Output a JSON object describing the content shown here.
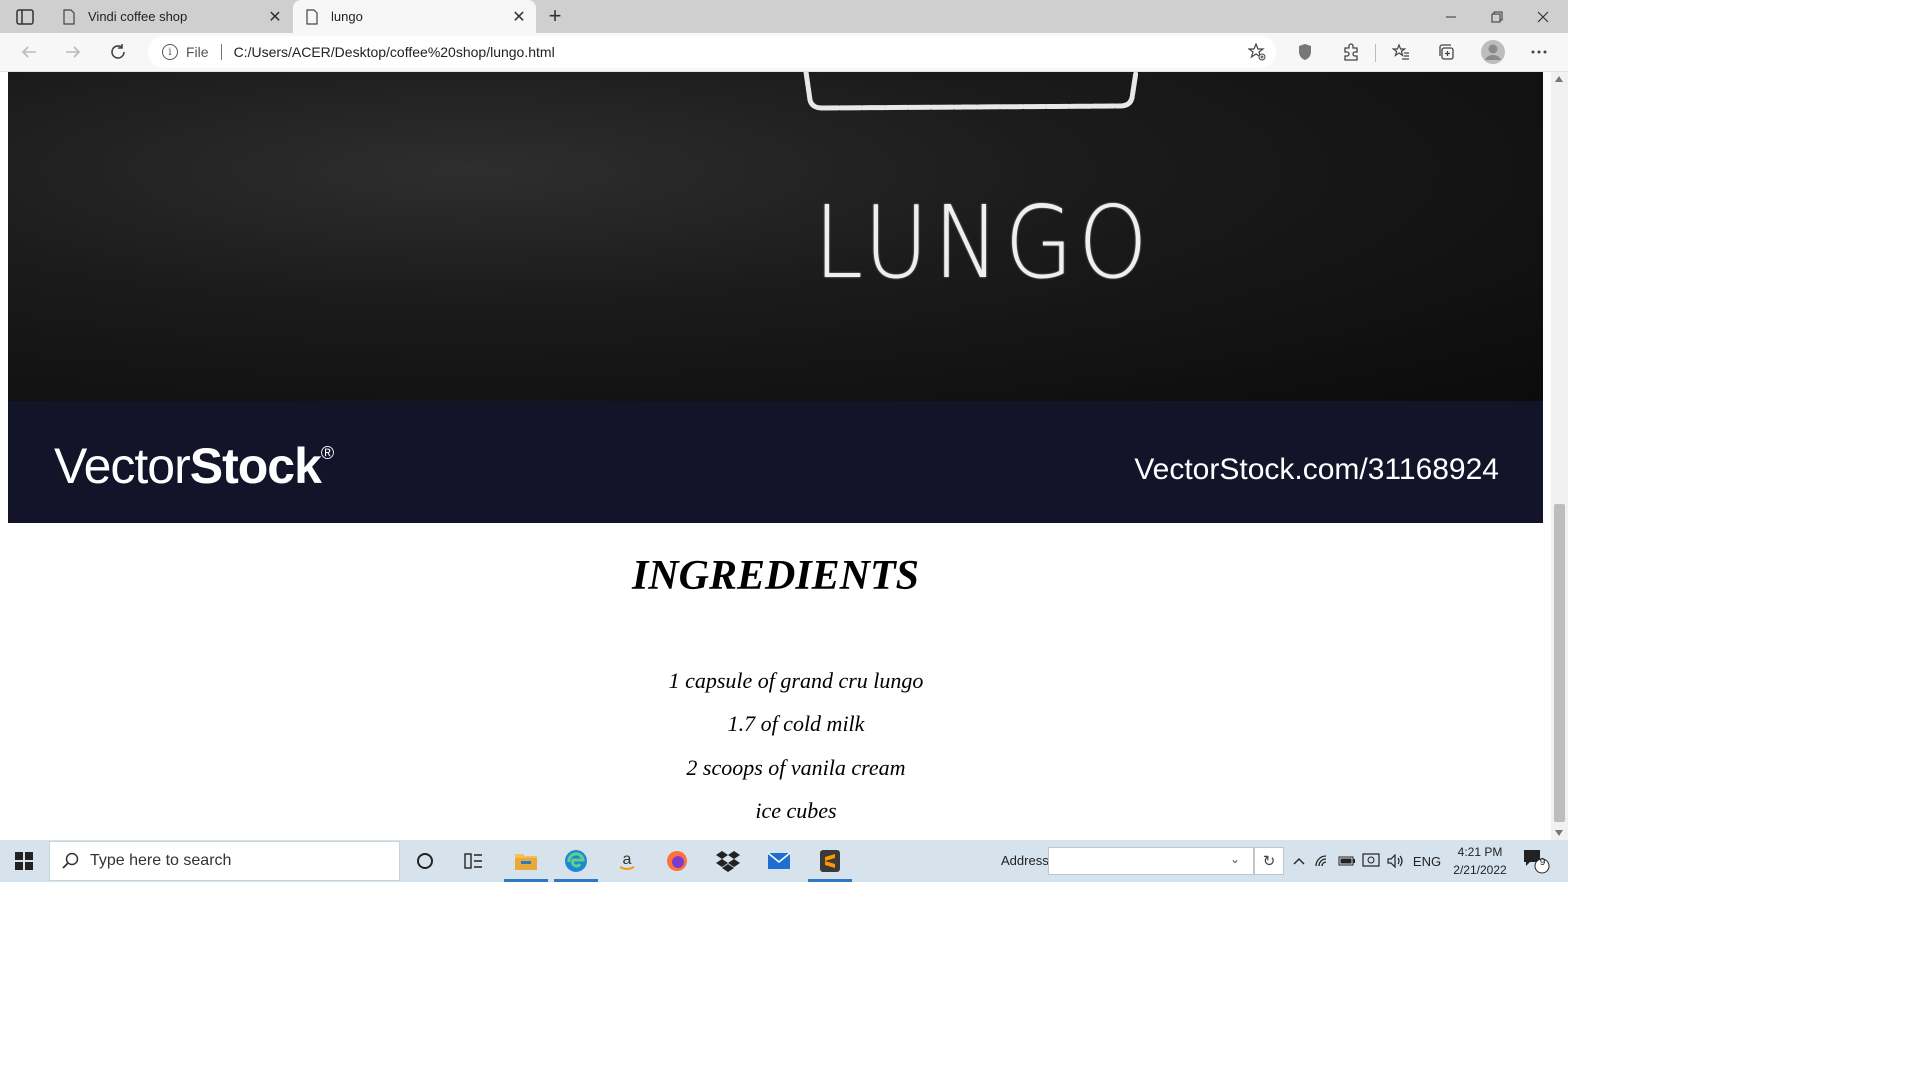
{
  "browser": {
    "tabs": [
      {
        "title": "Vindi coffee shop",
        "active": false
      },
      {
        "title": "lungo",
        "active": true
      }
    ],
    "address": {
      "protocol_label": "File",
      "url": "C:/Users/ACER/Desktop/coffee%20shop/lungo.html"
    }
  },
  "page": {
    "hero_word": "LUNGO",
    "stock_brand_light": "Vector",
    "stock_brand_bold": "Stock",
    "stock_brand_reg": "®",
    "stock_id": "VectorStock.com/31168924",
    "heading": "INGREDIENTS",
    "ingredients": [
      "1 capsule of grand cru lungo",
      "1.7 of cold milk",
      "2 scoops of vanila cream",
      "ice cubes"
    ]
  },
  "taskbar": {
    "search_placeholder": "Type here to search",
    "address_label": "Address",
    "language": "ENG",
    "time": "4:21 PM",
    "date": "2/21/2022",
    "notification_count": "9"
  },
  "colors": {
    "hero_bg": "#111111",
    "stock_bar": "#13132a",
    "taskbar": "#d6e3ec",
    "tab_strip": "#cfcfcf"
  }
}
